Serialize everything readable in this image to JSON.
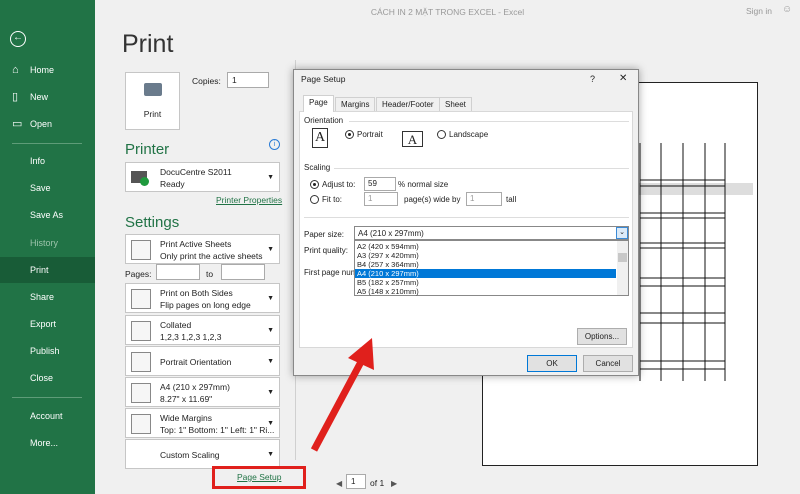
{
  "window": {
    "title": "CÁCH IN 2 MẶT TRONG EXCEL  -  Excel",
    "sign_in": "Sign in"
  },
  "sidebar": {
    "items": [
      {
        "label": "Home",
        "icon": "home-icon"
      },
      {
        "label": "New",
        "icon": "new-icon"
      },
      {
        "label": "Open",
        "icon": "open-icon"
      },
      {
        "label": "Info"
      },
      {
        "label": "Save"
      },
      {
        "label": "Save As"
      },
      {
        "label": "History"
      },
      {
        "label": "Print"
      },
      {
        "label": "Share"
      },
      {
        "label": "Export"
      },
      {
        "label": "Publish"
      },
      {
        "label": "Close"
      },
      {
        "label": "Account"
      },
      {
        "label": "More..."
      }
    ]
  },
  "print": {
    "heading": "Print",
    "button": "Print",
    "copies_label": "Copies:",
    "copies": "1"
  },
  "printer": {
    "heading": "Printer",
    "name": "DocuCentre S2011",
    "status": "Ready",
    "properties": "Printer Properties"
  },
  "settings": {
    "heading": "Settings",
    "pages_label": "Pages:",
    "to_label": "to",
    "dropdowns": [
      {
        "line1": "Print Active Sheets",
        "line2": "Only print the active sheets"
      },
      {
        "line1": "Print on Both Sides",
        "line2": "Flip pages on long edge"
      },
      {
        "line1": "Collated",
        "line2": "1,2,3    1,2,3    1,2,3"
      },
      {
        "line1": "Portrait Orientation"
      },
      {
        "line1": "A4 (210 x 297mm)",
        "line2": "8.27\" x 11.69\""
      },
      {
        "line1": "Wide Margins",
        "line2": "Top: 1\" Bottom: 1\" Left: 1\" Ri..."
      },
      {
        "line1": "Custom Scaling"
      }
    ],
    "page_setup_link": "Page Setup"
  },
  "preview_nav": {
    "page": "1",
    "of": "of 1"
  },
  "dialog": {
    "title": "Page Setup",
    "help": "?",
    "close": "✕",
    "tabs": [
      "Page",
      "Margins",
      "Header/Footer",
      "Sheet"
    ],
    "orientation_label": "Orientation",
    "portrait": "Portrait",
    "landscape": "Landscape",
    "orientation_selected": "Portrait",
    "scaling_label": "Scaling",
    "adjust_to": "Adjust to:",
    "adjust_value": "59",
    "normal_size": "% normal size",
    "fit_to": "Fit to:",
    "fit_wide": "1",
    "pages_wide_by": "page(s) wide by",
    "fit_tall": "1",
    "tall": "tall",
    "paper_size_label": "Paper size:",
    "paper_size": "A4 (210 x 297mm)",
    "paper_options": [
      "A2 (420 x 594mm)",
      "A3 (297 x 420mm)",
      "B4 (257 x 364mm)",
      "A4 (210 x 297mm)",
      "B5 (182 x 257mm)",
      "A5 (148 x 210mm)"
    ],
    "selected_index": 3,
    "print_quality_label": "Print quality:",
    "first_page_label": "First page num",
    "options": "Options...",
    "ok": "OK",
    "cancel": "Cancel"
  },
  "colors": {
    "accent": "#217346",
    "highlight": "#0078d7",
    "annotation": "#e0201c"
  }
}
